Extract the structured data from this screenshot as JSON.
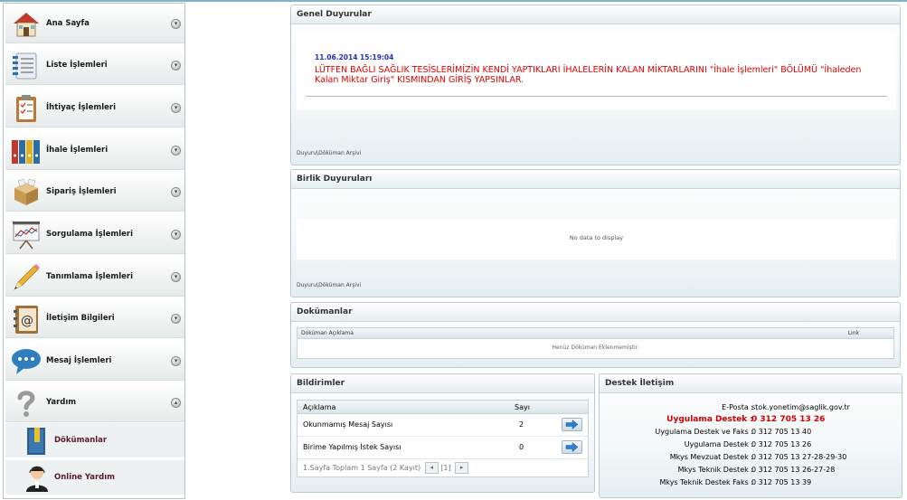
{
  "sidebar": {
    "items": [
      {
        "label": "Ana Sayfa",
        "icon": "house-icon"
      },
      {
        "label": "Liste İşlemleri",
        "icon": "list-icon"
      },
      {
        "label": "İhtiyaç İşlemleri",
        "icon": "clipboard-icon"
      },
      {
        "label": "İhale İşlemleri",
        "icon": "binders-icon"
      },
      {
        "label": "Sipariş İşlemleri",
        "icon": "box-icon"
      },
      {
        "label": "Sorgulama İşlemleri",
        "icon": "chart-board-icon"
      },
      {
        "label": "Tanımlama İşlemleri",
        "icon": "pencil-icon"
      },
      {
        "label": "İletişim Bilgileri",
        "icon": "address-book-icon"
      },
      {
        "label": "Mesaj İşlemleri",
        "icon": "speech-bubble-icon"
      },
      {
        "label": "Yardım",
        "icon": "question-icon"
      }
    ],
    "subitems": [
      {
        "label": "Dökümanlar",
        "icon": "document-book-icon"
      },
      {
        "label": "Online Yardım",
        "icon": "support-agent-icon"
      }
    ]
  },
  "genel": {
    "title": "Genel Duyurular",
    "date": "11.06.2014 15:19:04",
    "text": "LÜTFEN BAĞLI SAĞLIK TESİSLERİMİZİN KENDİ YAPTIKLARI İHALELERİN KALAN MİKTARLARINI \"İhale İşlemleri\" BÖLÜMÜ \"İhaleden Kalan Miktar Giriş\" KISMINDAN GİRİŞ YAPSINLAR.",
    "archive_link": "Duyuru\\Döküman Arşivi"
  },
  "birlik": {
    "title": "Birlik Duyuruları",
    "empty": "No data to display",
    "archive_link": "Duyuru\\Döküman Arşivi"
  },
  "dokumanlar": {
    "title": "Dokümanlar",
    "col_desc": "Doküman Açıklama",
    "col_link": "Link",
    "empty": "Henüz Döküman Eklenmemiştir."
  },
  "bildirimler": {
    "title": "Bildirimler",
    "col_desc": "Açıklama",
    "col_count": "Sayı",
    "rows": [
      {
        "label": "Okunmamış Mesaj Sayısı",
        "count": "2"
      },
      {
        "label": "Birime Yapılmış İstek Sayısı",
        "count": "0"
      }
    ],
    "pager": "1.Sayfa Toplam 1 Sayfa (2 Kayıt)",
    "page": "[1]"
  },
  "destek": {
    "title": "Destek İletişim",
    "lines": [
      {
        "label": "E-Posta :",
        "value": "stok.yonetim@saglik.gov.tr"
      },
      {
        "label": "Uygulama Destek :",
        "value": "0 312 705 13 26"
      },
      {
        "label": "Uygulama Destek ve Faks :",
        "value": "0 312 705 13 40"
      },
      {
        "label": "Uygulama Destek :",
        "value": "0 312 705 13 26"
      },
      {
        "label": "Mkys Mevzuat Destek :",
        "value": "0 312 705 13 27-28-29-30"
      },
      {
        "label": "Mkys Teknik Destek :",
        "value": "0 312 705 13 26-27-28"
      },
      {
        "label": "Mkys Teknik Destek Faks :",
        "value": "0 312 705 13 39"
      }
    ]
  },
  "colors": {
    "accent_red": "#e00000",
    "date_blue": "#1f2fbf",
    "panel_border": "#b9ccd3"
  }
}
